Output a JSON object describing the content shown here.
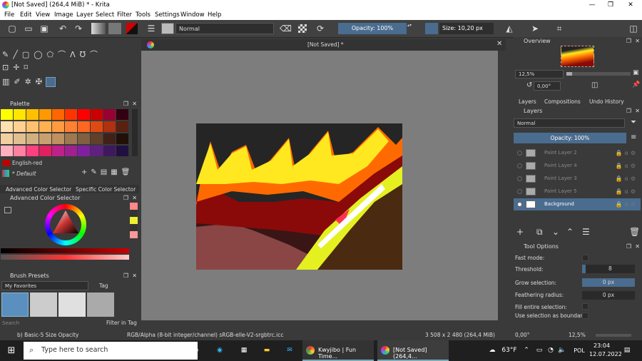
{
  "window": {
    "title": "[Not Saved]  (264,4 MiB)  * - Krita"
  },
  "menu": [
    "File",
    "Edit",
    "View",
    "Image",
    "Layer",
    "Select",
    "Filter",
    "Tools",
    "Settings",
    "Window",
    "Help"
  ],
  "toolbar": {
    "blend_mode": "Normal",
    "opacity_label": "Opacity: 100%",
    "size_label": "Size: 10,20 px"
  },
  "canvas": {
    "tab_title": "[Not Saved]  *",
    "accent": "#4a6c8f"
  },
  "palette": {
    "title": "Palette",
    "color_name": "English-red",
    "preset": "* Default",
    "colors": [
      [
        "#ffff00",
        "#ffe600",
        "#ffc000",
        "#ff9900",
        "#ff6600",
        "#ff3300",
        "#ff0000",
        "#cc0000",
        "#990033",
        "#330011"
      ],
      [
        "#ffe0b0",
        "#ffd090",
        "#ffc070",
        "#ffb050",
        "#ff9a40",
        "#ff8030",
        "#ff6620",
        "#e04a10",
        "#b03010",
        "#5a2010"
      ],
      [
        "#f0d0a0",
        "#e0c090",
        "#d0b080",
        "#c8a070",
        "#c09060",
        "#a07850",
        "#806040",
        "#604028",
        "#402018",
        "#201008"
      ],
      [
        "#ffb0c0",
        "#ff80a0",
        "#ff4080",
        "#e02060",
        "#c0208a",
        "#a02090",
        "#8020a0",
        "#602080",
        "#401860",
        "#201040"
      ]
    ]
  },
  "color_selector": {
    "tab1": "Advanced Color Selector",
    "tab2": "Specific Color Selector",
    "title": "Advanced Color Selector"
  },
  "brush_presets": {
    "title": "Brush Presets",
    "filter": "My Favorites",
    "tag": "Tag",
    "search_placeholder": "Search",
    "filter_in_tag": "Filter in Tag"
  },
  "overview": {
    "title": "Overview",
    "zoom": "12,5%",
    "rotation": "0,00°"
  },
  "layers": {
    "tabs": [
      "Layers",
      "Compositions",
      "Undo History"
    ],
    "title": "Layers",
    "blend_mode": "Normal",
    "opacity": "Opacity:  100%",
    "items": [
      {
        "name": "Paint Layer 2",
        "active": false
      },
      {
        "name": "Paint Layer 4",
        "active": false
      },
      {
        "name": "Paint Layer 3",
        "active": false
      },
      {
        "name": "Paint Layer 5",
        "active": false
      },
      {
        "name": "Background",
        "active": true
      }
    ]
  },
  "tool_options": {
    "title": "Tool Options",
    "fast_mode": "Fast mode:",
    "threshold": "Threshold:",
    "threshold_val": "8",
    "grow": "Grow selection:",
    "grow_val": "0 px",
    "feather": "Feathering radius:",
    "feather_val": "0 px",
    "fill_entire": "Fill entire selection:",
    "use_boundary": "Use selection as boundary:"
  },
  "status": {
    "brush": "b) Basic-5 Size Opacity",
    "color_space": "RGB/Alpha (8-bit integer/channel)  sRGB-elle-V2-srgbtrc.icc",
    "dims": "3 508 x 2 480 (264,4 MiB)",
    "rotation": "0,00°",
    "zoom": "12,5%"
  },
  "taskbar": {
    "search": "Type here to search",
    "app1": "Kwyjibo | Fun Time...",
    "app2": "[Not Saved] (264,4...",
    "weather": "63°F",
    "lang": "POL",
    "time": "23:04",
    "date": "12.07.2022"
  }
}
